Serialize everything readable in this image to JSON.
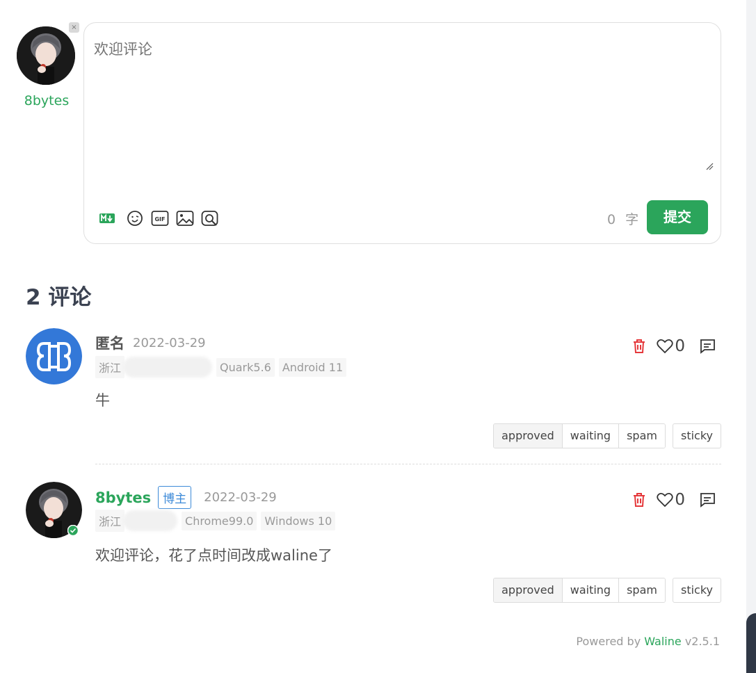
{
  "login": {
    "nick": "8bytes",
    "logout_symbol": "×"
  },
  "editor": {
    "placeholder": "欢迎评论",
    "word_count": "0",
    "word_unit": "字",
    "submit_label": "提交"
  },
  "toolbar": {
    "icons": [
      "markdown-icon",
      "emoji-icon",
      "gif-icon",
      "image-icon",
      "preview-icon"
    ]
  },
  "comments_header": {
    "count_title": "2 评论"
  },
  "comments": [
    {
      "nick": "匿名",
      "time": "2022-03-29",
      "location": "浙江",
      "browser": "Quark5.6",
      "os": "Android 11",
      "text": "牛",
      "likes": "0",
      "status_buttons": [
        "approved",
        "waiting",
        "spam"
      ],
      "sticky_label": "sticky"
    },
    {
      "nick": "8bytes",
      "badge": "博主",
      "time": "2022-03-29",
      "location": "浙江",
      "browser": "Chrome99.0",
      "os": "Windows 10",
      "text": "欢迎评论，花了点时间改成waline了",
      "likes": "0",
      "status_buttons": [
        "approved",
        "waiting",
        "spam"
      ],
      "sticky_label": "sticky"
    }
  ],
  "footer": {
    "prefix": "Powered by ",
    "brand": "Waline",
    "version": " v2.5.1"
  },
  "colors": {
    "accent": "#2ba55b",
    "badge": "#3c8ad8",
    "delete": "#e5383b",
    "title": "#3b4251"
  }
}
